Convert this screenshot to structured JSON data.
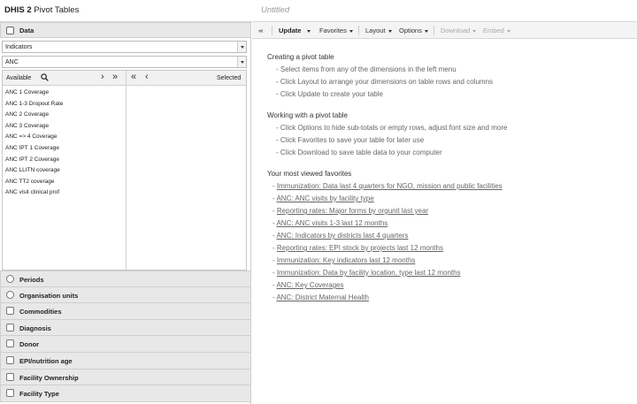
{
  "app": {
    "name_bold": "DHIS 2",
    "name_rest": " Pivot Tables",
    "doc_title": "Untitled"
  },
  "left": {
    "data_header": "Data",
    "data_type_select": "Indicators",
    "group_select": "ANC",
    "available_label": "Available",
    "selected_label": "Selected",
    "move_right": "›",
    "move_all_right": "»",
    "move_all_left": "«",
    "move_left": "‹",
    "available_items": [
      "ANC 1 Coverage",
      "ANC 1-3 Dropout Rate",
      "ANC 2 Coverage",
      "ANC 3 Coverage",
      "ANC => 4 Coverage",
      "ANC IPT 1 Coverage",
      "ANC IPT 2 Coverage",
      "ANC LLITN coverage",
      "ANC TT2 coverage",
      "ANC visit clinical prof"
    ],
    "dimensions": [
      {
        "label": "Periods",
        "icon": "clock-icon"
      },
      {
        "label": "Organisation units",
        "icon": "org-unit-icon"
      },
      {
        "label": "Commodities",
        "icon": "dimension-icon"
      },
      {
        "label": "Diagnosis",
        "icon": "dimension-icon"
      },
      {
        "label": "Donor",
        "icon": "dimension-icon"
      },
      {
        "label": "EPI/nutrition age",
        "icon": "dimension-icon"
      },
      {
        "label": "Facility Ownership",
        "icon": "dimension-icon"
      },
      {
        "label": "Facility Type",
        "icon": "dimension-icon"
      }
    ]
  },
  "toolbar": {
    "collapse": "«‹",
    "update": "Update",
    "favorites": "Favorites",
    "layout": "Layout",
    "options": "Options",
    "download": "Download",
    "embed": "Embed"
  },
  "content": {
    "section1_title": "Creating a pivot table",
    "section1_items": [
      "- Select items from any of the dimensions in the left menu",
      "- Click Layout to arrange your dimensions on table rows and columns",
      "- Click Update to create your table"
    ],
    "section2_title": "Working with a pivot table",
    "section2_items": [
      "- Click Options to hide sub-totals or empty rows, adjust font size and more",
      "- Click Favorites to save your table for later use",
      "- Click Download to save table data to your computer"
    ],
    "section3_title": "Your most viewed favorites",
    "favorites": [
      "Immunization: Data last 4 quarters for NGO, mission and public facilities",
      "ANC: ANC visits by facility type",
      "Reporting rates: Major forms by orgunit last year",
      "ANC: ANC visits 1-3 last 12 months",
      "ANC: Indicators by districts last 4 quarters",
      "Reporting rates: EPI stock by projects last 12 months",
      "Immunization: Key indicators last 12 months",
      "Immunization: Data by facility location, type last 12 months",
      "ANC: Key Coverages",
      "ANC: District Maternal Health"
    ]
  }
}
